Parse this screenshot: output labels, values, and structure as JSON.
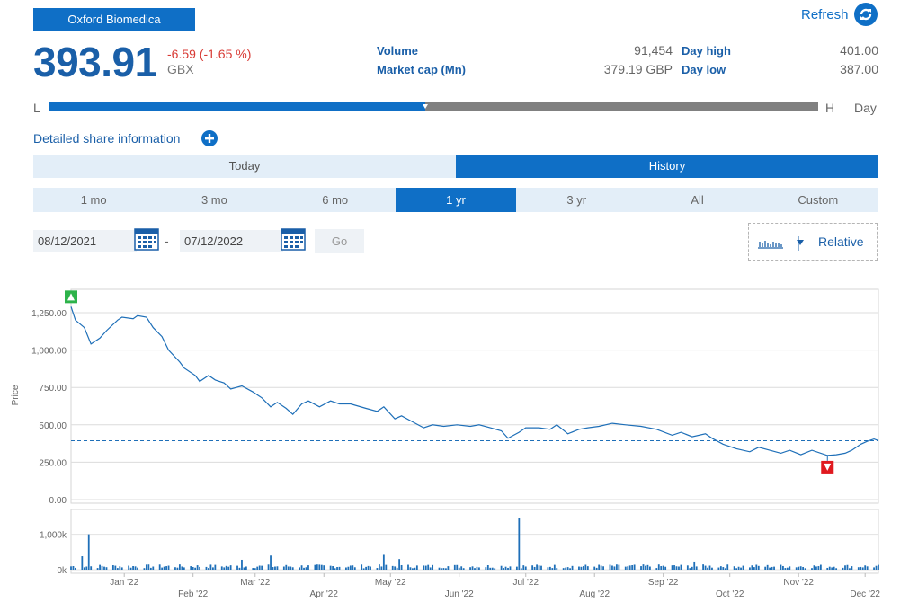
{
  "company": {
    "name": "Oxford Biomedica"
  },
  "refresh": {
    "label": "Refresh"
  },
  "quote": {
    "price": "393.91",
    "change": "-6.59 (-1.65 %)",
    "currency": "GBX",
    "volume_label": "Volume",
    "volume": "91,454",
    "market_cap_label": "Market cap (Mn)",
    "market_cap": "379.19 GBP",
    "day_high_label": "Day high",
    "day_high": "401.00",
    "day_low_label": "Day low",
    "day_low": "387.00"
  },
  "range": {
    "low_label": "L",
    "high_label": "H",
    "period_label": "Day",
    "position": 0.49
  },
  "detail": {
    "label": "Detailed share information"
  },
  "tabs": [
    {
      "label": "Today"
    },
    {
      "label": "History"
    }
  ],
  "periods": [
    {
      "label": "1 mo"
    },
    {
      "label": "3 mo"
    },
    {
      "label": "6 mo"
    },
    {
      "label": "1 yr"
    },
    {
      "label": "3 yr"
    },
    {
      "label": "All"
    },
    {
      "label": "Custom"
    }
  ],
  "dates": {
    "from": "08/12/2021",
    "to": "07/12/2022",
    "separator": "-",
    "go": "Go"
  },
  "chart_type": {
    "label": "Relative"
  },
  "colors": {
    "accent": "#0f6fc6",
    "line": "#1e6fb8",
    "up_marker": "#2db34a",
    "down_marker": "#e0191f"
  },
  "chart_data": {
    "type": "line",
    "ylabel": "Price",
    "y_ticks": [
      "0.00",
      "250.00",
      "500.00",
      "750.00",
      "1,000.00",
      "1,250.00"
    ],
    "ylim": [
      0,
      1250
    ],
    "volume_ticks": [
      "0k",
      "1,000k"
    ],
    "volume_ylim": [
      0,
      1600
    ],
    "x_tick_labels": [
      "Jan '22",
      "Feb '22",
      "Mar '22",
      "Apr '22",
      "May '22",
      "Jun '22",
      "Jul '22",
      "Aug '22",
      "Sep '22",
      "Oct '22",
      "Nov '22",
      "Dec '22"
    ],
    "reference_line": 393.91,
    "high_marker": {
      "date": "2021-12-08",
      "value": 1290
    },
    "low_marker": {
      "date": "2022-11-14",
      "value": 295
    },
    "price_series": [
      [
        "2021-12-08",
        1290
      ],
      [
        "2021-12-10",
        1200
      ],
      [
        "2021-12-14",
        1150
      ],
      [
        "2021-12-17",
        1040
      ],
      [
        "2021-12-21",
        1080
      ],
      [
        "2021-12-24",
        1130
      ],
      [
        "2021-12-29",
        1200
      ],
      [
        "2021-12-31",
        1220
      ],
      [
        "2022-01-05",
        1210
      ],
      [
        "2022-01-07",
        1230
      ],
      [
        "2022-01-11",
        1220
      ],
      [
        "2022-01-14",
        1150
      ],
      [
        "2022-01-18",
        1090
      ],
      [
        "2022-01-21",
        1000
      ],
      [
        "2022-01-26",
        920
      ],
      [
        "2022-01-28",
        880
      ],
      [
        "2022-02-02",
        830
      ],
      [
        "2022-02-04",
        790
      ],
      [
        "2022-02-08",
        830
      ],
      [
        "2022-02-11",
        800
      ],
      [
        "2022-02-15",
        780
      ],
      [
        "2022-02-18",
        740
      ],
      [
        "2022-02-23",
        760
      ],
      [
        "2022-02-28",
        720
      ],
      [
        "2022-03-04",
        680
      ],
      [
        "2022-03-08",
        620
      ],
      [
        "2022-03-11",
        650
      ],
      [
        "2022-03-15",
        610
      ],
      [
        "2022-03-18",
        570
      ],
      [
        "2022-03-22",
        640
      ],
      [
        "2022-03-25",
        660
      ],
      [
        "2022-03-30",
        620
      ],
      [
        "2022-04-04",
        660
      ],
      [
        "2022-04-08",
        640
      ],
      [
        "2022-04-13",
        640
      ],
      [
        "2022-04-20",
        610
      ],
      [
        "2022-04-25",
        590
      ],
      [
        "2022-04-28",
        620
      ],
      [
        "2022-05-03",
        540
      ],
      [
        "2022-05-06",
        560
      ],
      [
        "2022-05-11",
        520
      ],
      [
        "2022-05-16",
        480
      ],
      [
        "2022-05-20",
        500
      ],
      [
        "2022-05-25",
        490
      ],
      [
        "2022-05-31",
        500
      ],
      [
        "2022-06-06",
        490
      ],
      [
        "2022-06-10",
        500
      ],
      [
        "2022-06-15",
        480
      ],
      [
        "2022-06-20",
        460
      ],
      [
        "2022-06-23",
        410
      ],
      [
        "2022-06-28",
        450
      ],
      [
        "2022-07-01",
        480
      ],
      [
        "2022-07-07",
        480
      ],
      [
        "2022-07-12",
        470
      ],
      [
        "2022-07-15",
        500
      ],
      [
        "2022-07-20",
        440
      ],
      [
        "2022-07-25",
        470
      ],
      [
        "2022-07-29",
        480
      ],
      [
        "2022-08-03",
        490
      ],
      [
        "2022-08-09",
        510
      ],
      [
        "2022-08-15",
        500
      ],
      [
        "2022-08-22",
        490
      ],
      [
        "2022-08-29",
        470
      ],
      [
        "2022-09-05",
        430
      ],
      [
        "2022-09-09",
        450
      ],
      [
        "2022-09-14",
        420
      ],
      [
        "2022-09-20",
        440
      ],
      [
        "2022-09-23",
        410
      ],
      [
        "2022-09-28",
        370
      ],
      [
        "2022-10-04",
        340
      ],
      [
        "2022-10-10",
        320
      ],
      [
        "2022-10-14",
        350
      ],
      [
        "2022-10-19",
        330
      ],
      [
        "2022-10-24",
        310
      ],
      [
        "2022-10-28",
        330
      ],
      [
        "2022-11-02",
        300
      ],
      [
        "2022-11-07",
        330
      ],
      [
        "2022-11-14",
        295
      ],
      [
        "2022-11-18",
        300
      ],
      [
        "2022-11-22",
        310
      ],
      [
        "2022-11-25",
        330
      ],
      [
        "2022-11-29",
        370
      ],
      [
        "2022-12-02",
        390
      ],
      [
        "2022-12-05",
        405
      ],
      [
        "2022-12-07",
        394
      ]
    ],
    "volume_spikes": [
      [
        "2021-12-16",
        1000
      ],
      [
        "2021-12-13",
        380
      ],
      [
        "2022-06-28",
        1450
      ],
      [
        "2022-02-23",
        280
      ],
      [
        "2022-03-08",
        400
      ],
      [
        "2022-04-28",
        420
      ],
      [
        "2022-05-05",
        300
      ],
      [
        "2022-09-15",
        230
      ]
    ]
  }
}
